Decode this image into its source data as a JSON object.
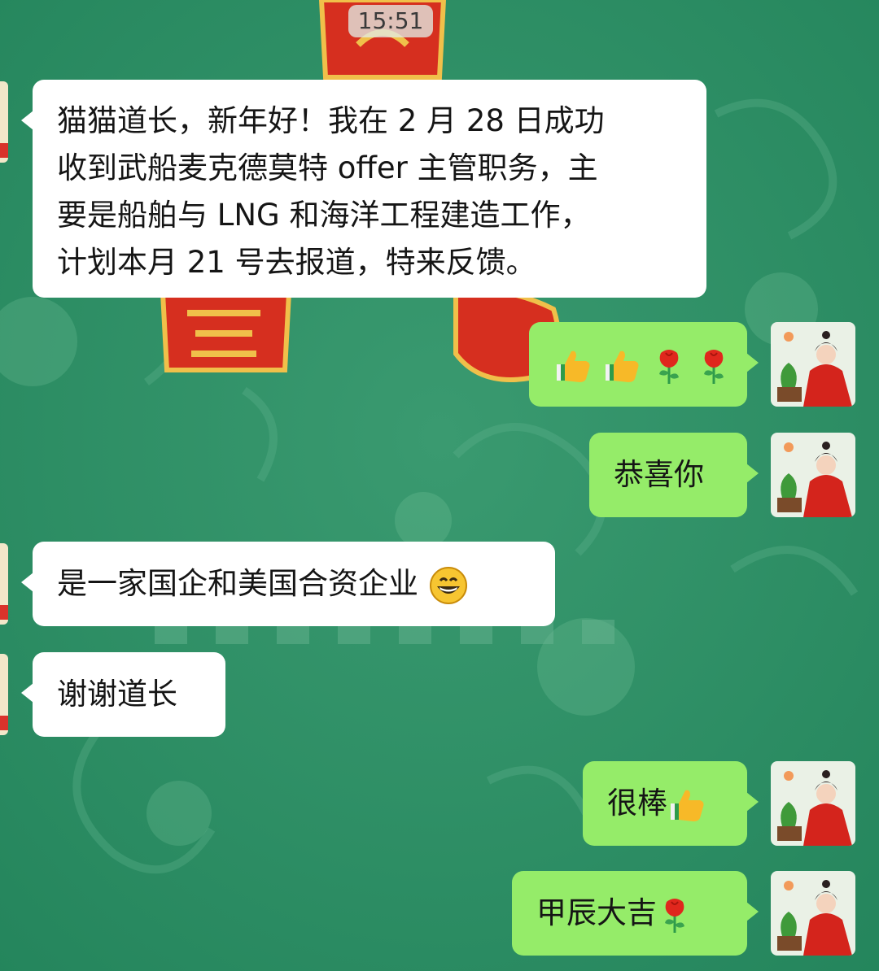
{
  "status": {
    "time": "15:51"
  },
  "messages": [
    {
      "side": "in",
      "lines": [
        "猫猫道长，新年好！我在 2 月 28 日成功",
        "收到武船麦克德莫特 offer 主管职务，主",
        "要是船舶与 LNG 和海洋工程建造工作，",
        "计划本月 21 号去报道，特来反馈。"
      ]
    },
    {
      "side": "out",
      "text": "",
      "emojis": [
        "thumbs-up-icon",
        "thumbs-up-icon",
        "rose-icon",
        "rose-icon"
      ]
    },
    {
      "side": "out",
      "text": "恭喜你"
    },
    {
      "side": "in",
      "text": "是一家国企和美国合资企业",
      "emojis": [
        "grinning-face-icon"
      ]
    },
    {
      "side": "in",
      "text": "谢谢道长"
    },
    {
      "side": "out",
      "text": "很棒",
      "emojis": [
        "thumbs-up-icon"
      ]
    },
    {
      "side": "out",
      "text": "甲辰大吉",
      "emojis": [
        "rose-icon"
      ]
    }
  ],
  "colors": {
    "background": "#2f8f67",
    "incoming_bubble": "#ffffff",
    "outgoing_bubble": "#95ec69"
  }
}
